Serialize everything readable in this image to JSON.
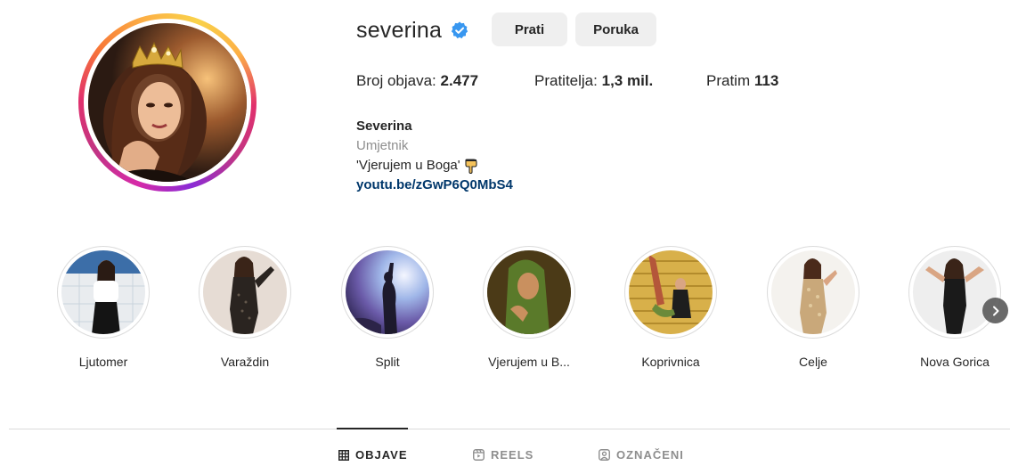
{
  "profile": {
    "username": "severina",
    "verified": true,
    "follow_label": "Prati",
    "message_label": "Poruka"
  },
  "stats": {
    "posts_label": "Broj objava:",
    "posts_value": "2.477",
    "followers_label": "Pratitelja:",
    "followers_value": "1,3 mil.",
    "following_label": "Pratim",
    "following_value": "113"
  },
  "bio": {
    "name": "Severina",
    "category": "Umjetnik",
    "text": "'Vjerujem u Boga'",
    "link": "youtu.be/zGwP6Q0MbS4"
  },
  "highlights": [
    {
      "label": "Ljutomer"
    },
    {
      "label": "Varaždin"
    },
    {
      "label": "Split"
    },
    {
      "label": "Vjerujem u B..."
    },
    {
      "label": "Koprivnica"
    },
    {
      "label": "Celje"
    },
    {
      "label": "Nova Gorica"
    }
  ],
  "tabs": [
    {
      "label": "OBJAVE",
      "active": true
    },
    {
      "label": "REELS",
      "active": false
    },
    {
      "label": "OZNAČENI",
      "active": false
    }
  ],
  "colors": {
    "verified_blue": "#3897f0",
    "link_blue": "#00376b",
    "button_gray": "#efefef",
    "muted_text": "#8e8e8e"
  },
  "icons": {
    "verified": "verified-badge-icon",
    "pointing_hand": "backhand-index-pointing-down-emoji",
    "next": "chevron-right-icon",
    "posts_tab": "grid-icon",
    "reels_tab": "reels-icon",
    "tagged_tab": "tagged-user-icon"
  }
}
